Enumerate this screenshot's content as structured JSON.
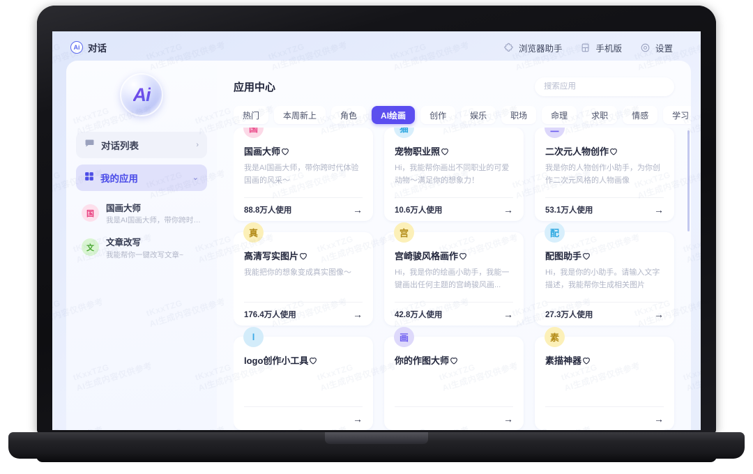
{
  "window": {
    "device": "laptop"
  },
  "topbar": {
    "brand_mark": "Ai",
    "brand_label": "对话",
    "items": [
      {
        "icon": "puzzle-icon",
        "label": "浏览器助手"
      },
      {
        "icon": "mobile-icon",
        "label": "手机版"
      },
      {
        "icon": "gear-icon",
        "label": "设置"
      }
    ]
  },
  "sidebar": {
    "logo_text": "Ai",
    "nav": [
      {
        "icon": "chat-icon",
        "label": "对话列表",
        "chevron": "›",
        "active": false
      },
      {
        "icon": "grid-icon",
        "label": "我的应用",
        "chevron": "⌄",
        "active": true
      }
    ],
    "apps": [
      {
        "badge": "国",
        "badge_bg": "#fde0ec",
        "badge_fg": "#e8407f",
        "title": "国画大师",
        "desc": "我是AI国画大师，带你跨时代体..."
      },
      {
        "badge": "文",
        "badge_bg": "#d9f5d2",
        "badge_fg": "#4aa832",
        "title": "文章改写",
        "desc": "我能帮你一键改写文章~"
      }
    ]
  },
  "main": {
    "title": "应用中心",
    "search": {
      "value": "",
      "placeholder": "搜索应用"
    },
    "tabs": [
      {
        "label": "热门",
        "active": false
      },
      {
        "label": "本周新上",
        "active": false
      },
      {
        "label": "角色",
        "active": false
      },
      {
        "label": "AI绘画",
        "active": true
      },
      {
        "label": "创作",
        "active": false
      },
      {
        "label": "娱乐",
        "active": false
      },
      {
        "label": "职场",
        "active": false
      },
      {
        "label": "命理",
        "active": false
      },
      {
        "label": "求职",
        "active": false
      },
      {
        "label": "情感",
        "active": false
      },
      {
        "label": "学习",
        "active": false
      }
    ],
    "cards": [
      {
        "badge": "国",
        "badge_bg": "#fcd9e7",
        "badge_fg": "#ea4b8b",
        "title": "国画大师",
        "desc": "我是AI国画大师，带你跨时代体验国画的风采～",
        "uses": "88.8万人使用",
        "arrow": "→",
        "heart": "heart-outline-icon"
      },
      {
        "badge": "猫",
        "badge_bg": "#d8effc",
        "badge_fg": "#2fa8e0",
        "title": "宠物职业照",
        "desc": "Hi，我能帮你画出不同职业的可爱动物～满足你的想象力！",
        "uses": "10.6万人使用",
        "arrow": "→",
        "heart": "heart-outline-icon"
      },
      {
        "badge": "二",
        "badge_bg": "#ddd8fb",
        "badge_fg": "#6d5df0",
        "title": "二次元人物创作",
        "desc": "我是你的人物创作小助手，为你创作二次元风格的人物画像",
        "uses": "53.1万人使用",
        "arrow": "→",
        "heart": "heart-outline-icon"
      },
      {
        "badge": "真",
        "badge_bg": "#fcf0b8",
        "badge_fg": "#b38b18",
        "title": "高清写实图片",
        "desc": "我能把你的想象变成真实图像～",
        "uses": "176.4万人使用",
        "arrow": "→",
        "heart": "heart-outline-icon"
      },
      {
        "badge": "宫",
        "badge_bg": "#fcf0b8",
        "badge_fg": "#b38b18",
        "title": "宫崎骏风格画作",
        "desc": "Hi，我是你的绘画小助手，我能一键画出任何主题的宫崎骏风画...",
        "uses": "42.8万人使用",
        "arrow": "→",
        "heart": "heart-outline-icon"
      },
      {
        "badge": "配",
        "badge_bg": "#d8effc",
        "badge_fg": "#2fa8e0",
        "title": "配图助手",
        "desc": "Hi，我是你的小助手。请输入文字描述，我能帮你生成相关图片",
        "uses": "27.3万人使用",
        "arrow": "→",
        "heart": "heart-outline-icon"
      },
      {
        "badge": "l",
        "badge_bg": "#d3ecfa",
        "badge_fg": "#3aa9e6",
        "title": "logo创作小工具",
        "desc": "",
        "uses": "",
        "arrow": "→",
        "heart": "heart-outline-icon"
      },
      {
        "badge": "画",
        "badge_bg": "#ded9fb",
        "badge_fg": "#6d5df0",
        "title": "你的作图大师",
        "desc": "",
        "uses": "",
        "arrow": "→",
        "heart": "heart-outline-icon"
      },
      {
        "badge": "素",
        "badge_bg": "#fcf0b8",
        "badge_fg": "#b38b18",
        "title": "素描神器",
        "desc": "",
        "uses": "",
        "arrow": "→",
        "heart": "heart-outline-icon"
      }
    ]
  },
  "watermark": {
    "line1": "tKxxTZG",
    "line2": "AI生成内容仅供参考"
  },
  "colors": {
    "accent": "#5b4df0",
    "page_bg": "#e9eefc",
    "panel_bg": "#fbfcff"
  }
}
